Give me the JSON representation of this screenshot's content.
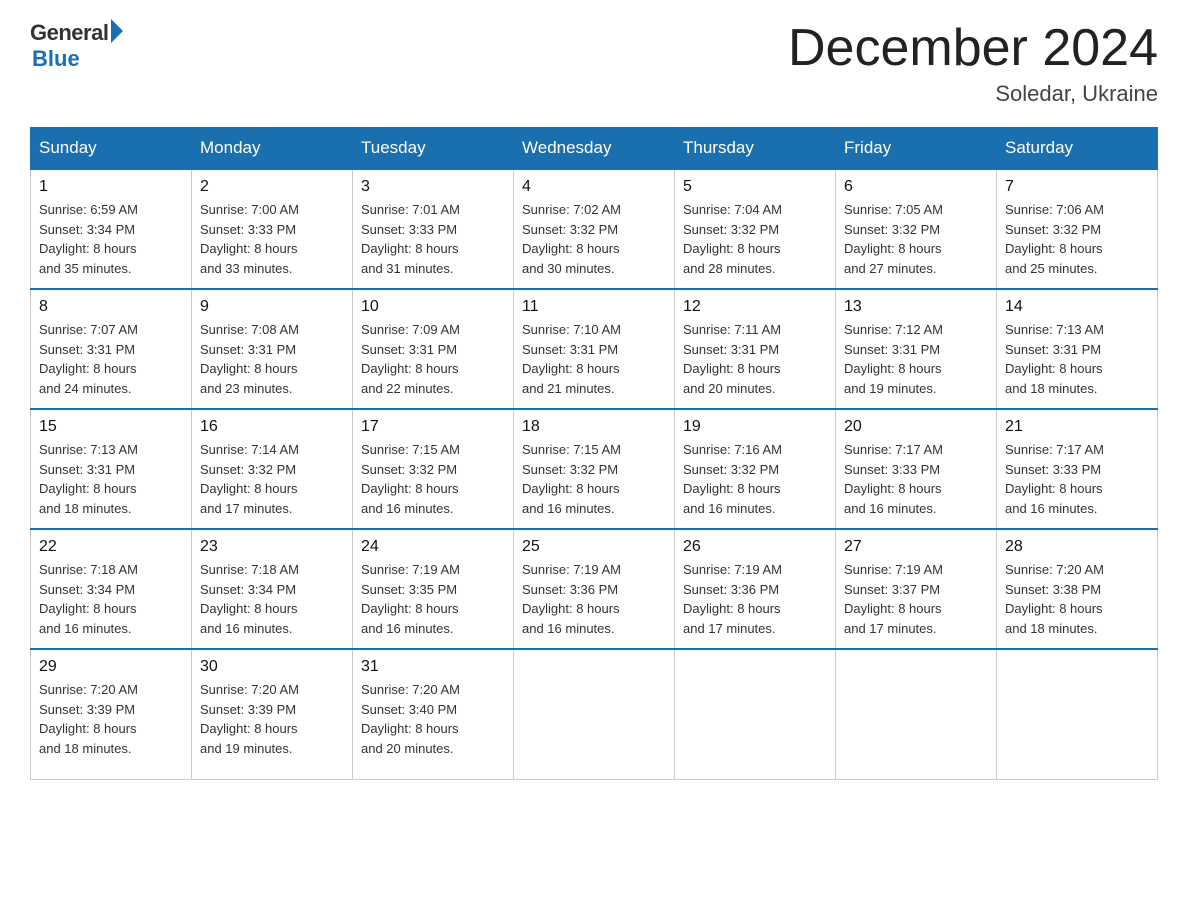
{
  "logo": {
    "general": "General",
    "blue": "Blue"
  },
  "title": "December 2024",
  "location": "Soledar, Ukraine",
  "days_of_week": [
    "Sunday",
    "Monday",
    "Tuesday",
    "Wednesday",
    "Thursday",
    "Friday",
    "Saturday"
  ],
  "weeks": [
    [
      {
        "day": "1",
        "info": "Sunrise: 6:59 AM\nSunset: 3:34 PM\nDaylight: 8 hours\nand 35 minutes."
      },
      {
        "day": "2",
        "info": "Sunrise: 7:00 AM\nSunset: 3:33 PM\nDaylight: 8 hours\nand 33 minutes."
      },
      {
        "day": "3",
        "info": "Sunrise: 7:01 AM\nSunset: 3:33 PM\nDaylight: 8 hours\nand 31 minutes."
      },
      {
        "day": "4",
        "info": "Sunrise: 7:02 AM\nSunset: 3:32 PM\nDaylight: 8 hours\nand 30 minutes."
      },
      {
        "day": "5",
        "info": "Sunrise: 7:04 AM\nSunset: 3:32 PM\nDaylight: 8 hours\nand 28 minutes."
      },
      {
        "day": "6",
        "info": "Sunrise: 7:05 AM\nSunset: 3:32 PM\nDaylight: 8 hours\nand 27 minutes."
      },
      {
        "day": "7",
        "info": "Sunrise: 7:06 AM\nSunset: 3:32 PM\nDaylight: 8 hours\nand 25 minutes."
      }
    ],
    [
      {
        "day": "8",
        "info": "Sunrise: 7:07 AM\nSunset: 3:31 PM\nDaylight: 8 hours\nand 24 minutes."
      },
      {
        "day": "9",
        "info": "Sunrise: 7:08 AM\nSunset: 3:31 PM\nDaylight: 8 hours\nand 23 minutes."
      },
      {
        "day": "10",
        "info": "Sunrise: 7:09 AM\nSunset: 3:31 PM\nDaylight: 8 hours\nand 22 minutes."
      },
      {
        "day": "11",
        "info": "Sunrise: 7:10 AM\nSunset: 3:31 PM\nDaylight: 8 hours\nand 21 minutes."
      },
      {
        "day": "12",
        "info": "Sunrise: 7:11 AM\nSunset: 3:31 PM\nDaylight: 8 hours\nand 20 minutes."
      },
      {
        "day": "13",
        "info": "Sunrise: 7:12 AM\nSunset: 3:31 PM\nDaylight: 8 hours\nand 19 minutes."
      },
      {
        "day": "14",
        "info": "Sunrise: 7:13 AM\nSunset: 3:31 PM\nDaylight: 8 hours\nand 18 minutes."
      }
    ],
    [
      {
        "day": "15",
        "info": "Sunrise: 7:13 AM\nSunset: 3:31 PM\nDaylight: 8 hours\nand 18 minutes."
      },
      {
        "day": "16",
        "info": "Sunrise: 7:14 AM\nSunset: 3:32 PM\nDaylight: 8 hours\nand 17 minutes."
      },
      {
        "day": "17",
        "info": "Sunrise: 7:15 AM\nSunset: 3:32 PM\nDaylight: 8 hours\nand 16 minutes."
      },
      {
        "day": "18",
        "info": "Sunrise: 7:15 AM\nSunset: 3:32 PM\nDaylight: 8 hours\nand 16 minutes."
      },
      {
        "day": "19",
        "info": "Sunrise: 7:16 AM\nSunset: 3:32 PM\nDaylight: 8 hours\nand 16 minutes."
      },
      {
        "day": "20",
        "info": "Sunrise: 7:17 AM\nSunset: 3:33 PM\nDaylight: 8 hours\nand 16 minutes."
      },
      {
        "day": "21",
        "info": "Sunrise: 7:17 AM\nSunset: 3:33 PM\nDaylight: 8 hours\nand 16 minutes."
      }
    ],
    [
      {
        "day": "22",
        "info": "Sunrise: 7:18 AM\nSunset: 3:34 PM\nDaylight: 8 hours\nand 16 minutes."
      },
      {
        "day": "23",
        "info": "Sunrise: 7:18 AM\nSunset: 3:34 PM\nDaylight: 8 hours\nand 16 minutes."
      },
      {
        "day": "24",
        "info": "Sunrise: 7:19 AM\nSunset: 3:35 PM\nDaylight: 8 hours\nand 16 minutes."
      },
      {
        "day": "25",
        "info": "Sunrise: 7:19 AM\nSunset: 3:36 PM\nDaylight: 8 hours\nand 16 minutes."
      },
      {
        "day": "26",
        "info": "Sunrise: 7:19 AM\nSunset: 3:36 PM\nDaylight: 8 hours\nand 17 minutes."
      },
      {
        "day": "27",
        "info": "Sunrise: 7:19 AM\nSunset: 3:37 PM\nDaylight: 8 hours\nand 17 minutes."
      },
      {
        "day": "28",
        "info": "Sunrise: 7:20 AM\nSunset: 3:38 PM\nDaylight: 8 hours\nand 18 minutes."
      }
    ],
    [
      {
        "day": "29",
        "info": "Sunrise: 7:20 AM\nSunset: 3:39 PM\nDaylight: 8 hours\nand 18 minutes."
      },
      {
        "day": "30",
        "info": "Sunrise: 7:20 AM\nSunset: 3:39 PM\nDaylight: 8 hours\nand 19 minutes."
      },
      {
        "day": "31",
        "info": "Sunrise: 7:20 AM\nSunset: 3:40 PM\nDaylight: 8 hours\nand 20 minutes."
      },
      {
        "day": "",
        "info": ""
      },
      {
        "day": "",
        "info": ""
      },
      {
        "day": "",
        "info": ""
      },
      {
        "day": "",
        "info": ""
      }
    ]
  ]
}
